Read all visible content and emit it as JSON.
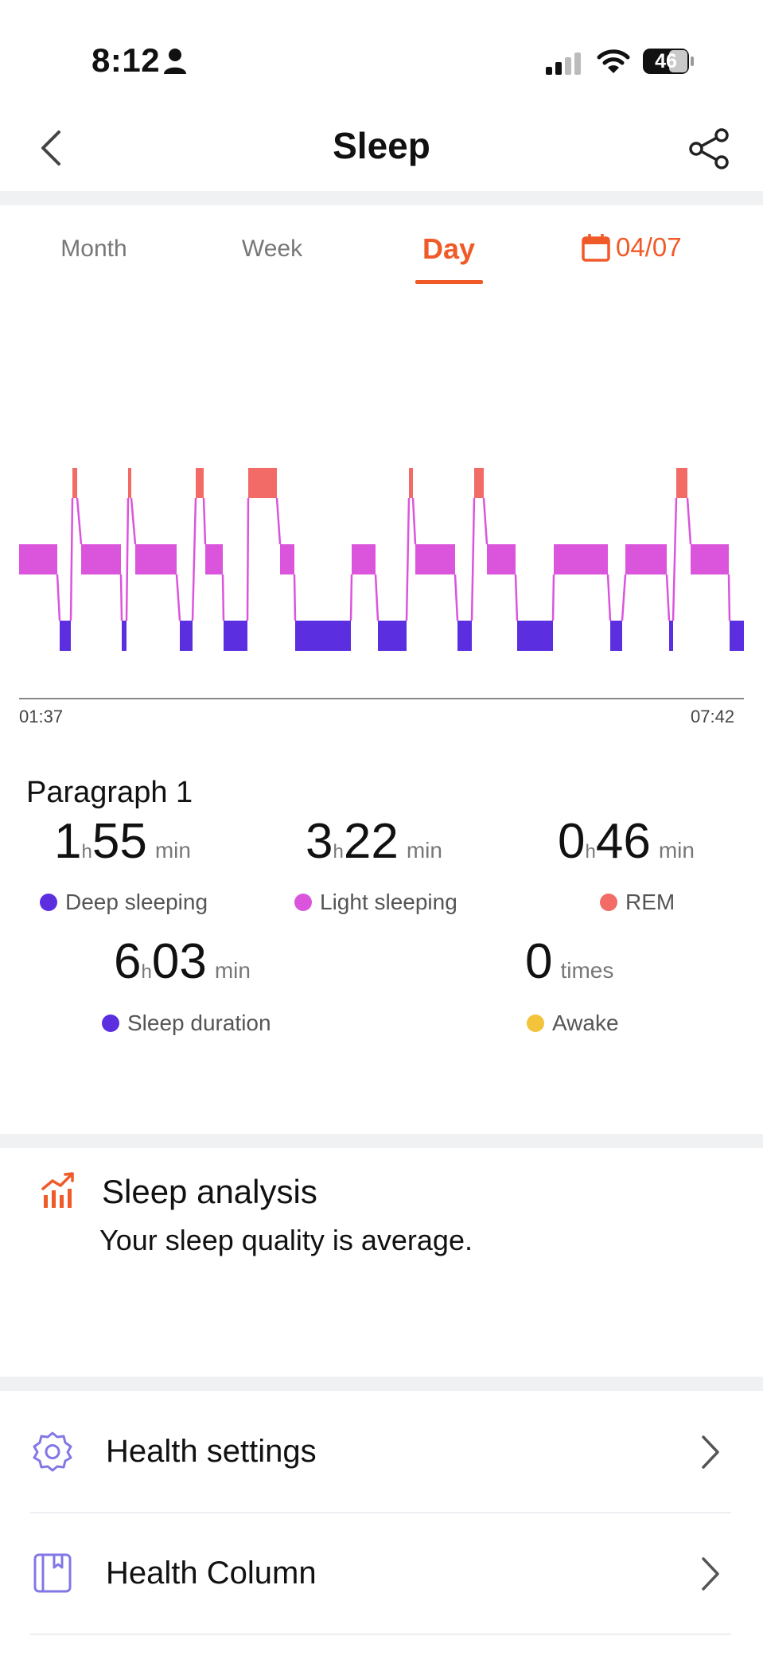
{
  "status_bar": {
    "time": "8:12",
    "battery": "46"
  },
  "header": {
    "title": "Sleep"
  },
  "tabs": [
    {
      "label": "Month"
    },
    {
      "label": "Week"
    },
    {
      "label": "Day"
    }
  ],
  "date": "04/07",
  "chart": {
    "start": "01:37",
    "end": "07:42"
  },
  "chart_data": {
    "type": "area",
    "x_range": [
      "01:37",
      "07:42"
    ],
    "stages": [
      "Deep sleeping",
      "Light sleeping",
      "REM"
    ],
    "legend_colors": {
      "Deep sleeping": "#5b2fe0",
      "Light sleeping": "#db55dc",
      "REM": "#f26b66"
    }
  },
  "paragraph": "Paragraph 1",
  "stats": {
    "deep": {
      "h": "1",
      "m": "55",
      "h_unit": "h",
      "m_unit": "min",
      "label": "Deep sleeping"
    },
    "light": {
      "h": "3",
      "m": "22",
      "h_unit": "h",
      "m_unit": "min",
      "label": "Light sleeping"
    },
    "rem": {
      "h": "0",
      "m": "46",
      "h_unit": "h",
      "m_unit": "min",
      "label": "REM"
    },
    "duration": {
      "h": "6",
      "m": "03",
      "h_unit": "h",
      "m_unit": "min",
      "label": "Sleep duration"
    },
    "awake": {
      "value": "0",
      "unit": "times",
      "label": "Awake"
    }
  },
  "colors": {
    "accent": "#f05a28",
    "deep": "#5b2fe0",
    "light": "#db55dc",
    "rem": "#f26b66",
    "awake": "#f2c33b",
    "duration": "#5b2fe0"
  },
  "analysis": {
    "title": "Sleep analysis",
    "text": "Your sleep quality is average."
  },
  "list": [
    {
      "label": "Health settings",
      "icon": "gear-icon"
    },
    {
      "label": "Health Column",
      "icon": "bookmark-book-icon"
    }
  ]
}
